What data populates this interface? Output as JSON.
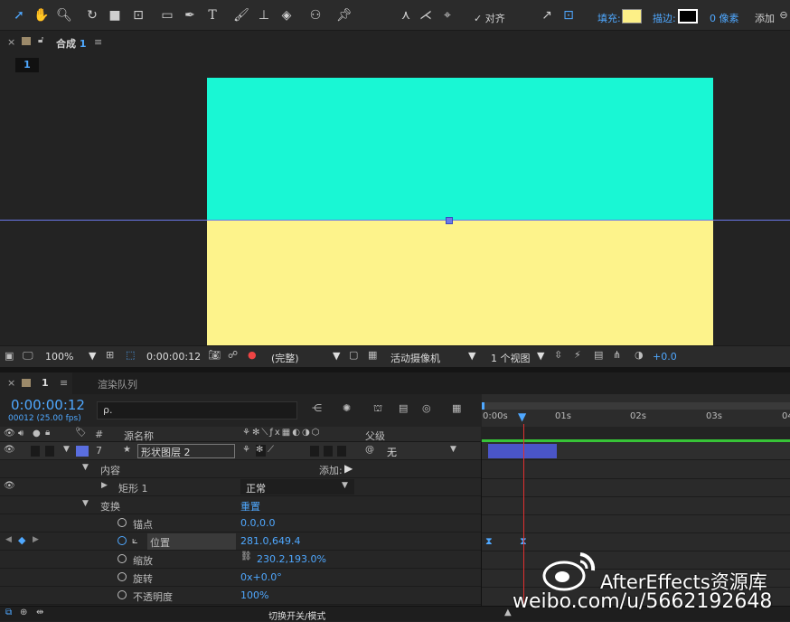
{
  "toolbar": {
    "align_label": "对齐",
    "fill_label": "填充:",
    "fill_color": "#fdf087",
    "stroke_label": "描边:",
    "stroke_value": "0 像素",
    "add_label": "添加"
  },
  "comp_panel": {
    "tab_label": "合成",
    "tab_number": "1",
    "sub_tab": "1"
  },
  "viewer": {
    "top_color": "#19f7d4",
    "bottom_color": "#fdf38b",
    "zoom": "100%",
    "timecode": "0:00:00:12",
    "resolution": "(完整)",
    "camera": "活动摄像机",
    "view_count": "1 个视图",
    "exposure": "+0.0"
  },
  "timeline": {
    "tab_number": "1",
    "render_queue": "渲染队列",
    "timecode": "0:00:00:12",
    "frames": "00012 (25.00 fps)",
    "search_placeholder": "ρ.",
    "col_hash": "#",
    "col_source": "源名称",
    "col_parent": "父级",
    "ruler_labels": [
      "0:00s",
      "01s",
      "02s",
      "03s",
      "04"
    ],
    "layer": {
      "number": "7",
      "name": "形状图层 2",
      "parent": "无",
      "color": "#5a6ee0"
    },
    "contents_label": "内容",
    "add_label": "添加:",
    "rect_label": "矩形 1",
    "blend_mode": "正常",
    "transform_label": "变换",
    "reset_label": "重置",
    "props": [
      {
        "name": "锚点",
        "value": "0.0,0.0"
      },
      {
        "name": "位置",
        "value": "281.0,649.4"
      },
      {
        "name": "缩放",
        "value": "230.2,193.0%"
      },
      {
        "name": "旋转",
        "value": "0x+0.0°"
      },
      {
        "name": "不透明度",
        "value": "100%"
      }
    ],
    "footer_label": "切换开关/模式"
  },
  "watermark": {
    "title": "AfterEffects资源库",
    "url": "weibo.com/u/5662192648"
  }
}
